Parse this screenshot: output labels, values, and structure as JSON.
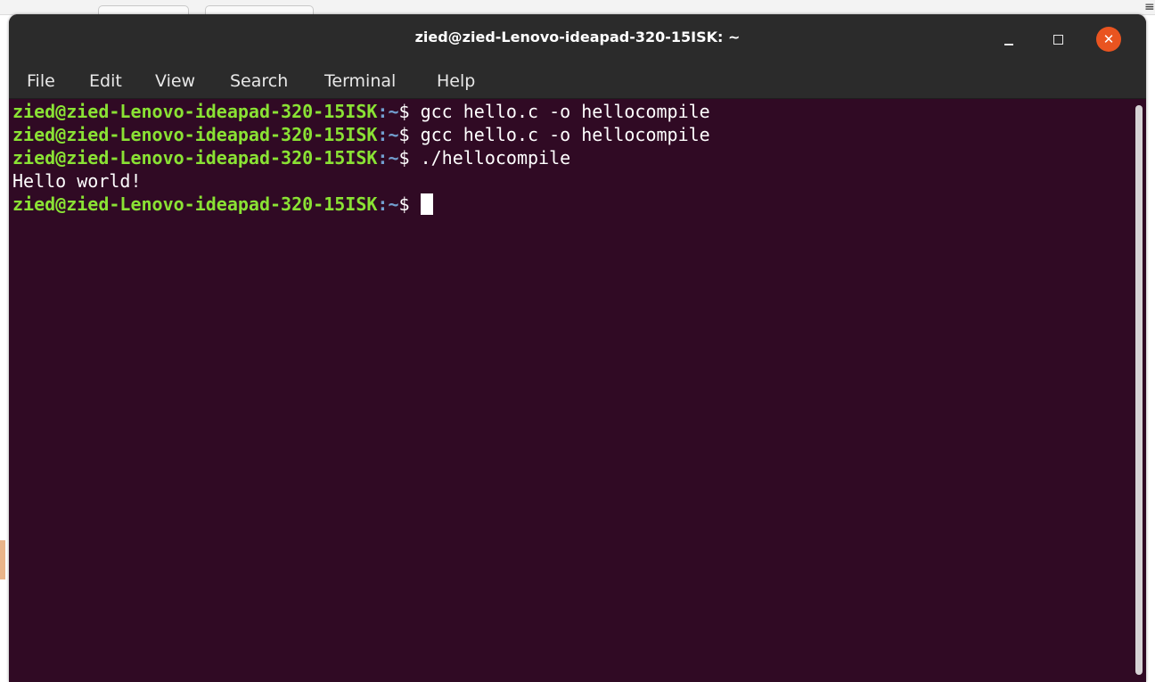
{
  "window": {
    "title": "zied@zied-Lenovo-ideapad-320-15ISK: ~",
    "minimize_icon": "minimize-icon",
    "maximize_icon": "maximize-icon",
    "close_icon": "close-icon",
    "close_symbol": "✕"
  },
  "menu": {
    "items": [
      "File",
      "Edit",
      "View",
      "Search",
      "Terminal",
      "Help"
    ]
  },
  "terminal": {
    "user_host": "zied@zied-Lenovo-ideapad-320-15ISK",
    "path": ":~",
    "prompt_symbol": "$ ",
    "lines": [
      {
        "type": "command",
        "command": "gcc hello.c -o hellocompile"
      },
      {
        "type": "command",
        "command": "gcc hello.c -o hellocompile"
      },
      {
        "type": "command",
        "command": "./hellocompile"
      },
      {
        "type": "output",
        "text": "Hello world!"
      },
      {
        "type": "prompt",
        "command": ""
      }
    ]
  },
  "colors": {
    "terminal_bg": "#300a24",
    "titlebar_bg": "#2b2b2b",
    "prompt_user": "#8ae234",
    "prompt_path": "#729fcf",
    "close_button": "#e95420"
  }
}
